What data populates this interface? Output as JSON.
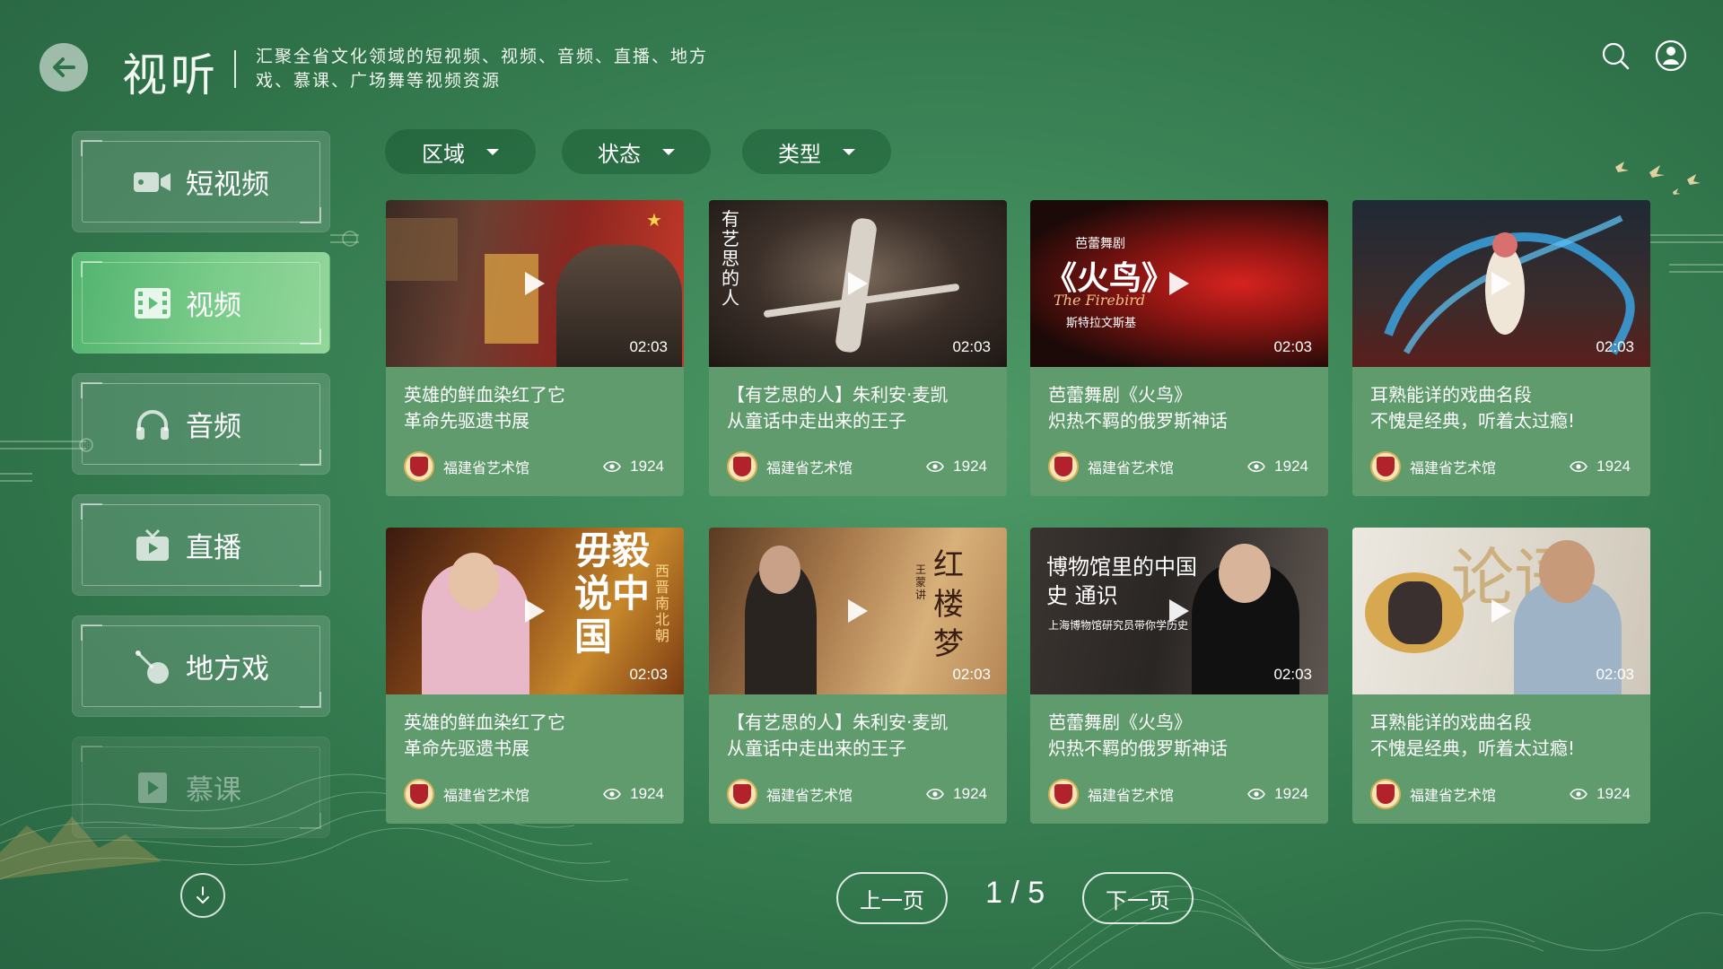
{
  "header": {
    "title": "视听",
    "description": "汇聚全省文化领域的短视频、视频、音频、直播、地方戏、慕课、广场舞等视频资源"
  },
  "sidebar": {
    "items": [
      {
        "label": "短视频",
        "icon": "video-camera-icon"
      },
      {
        "label": "视频",
        "icon": "film-icon"
      },
      {
        "label": "音频",
        "icon": "headphones-icon"
      },
      {
        "label": "直播",
        "icon": "tv-icon"
      },
      {
        "label": "地方戏",
        "icon": "opera-icon"
      },
      {
        "label": "慕课",
        "icon": "course-play-icon"
      }
    ],
    "active_index": 1
  },
  "filters": [
    {
      "label": "区域"
    },
    {
      "label": "状态"
    },
    {
      "label": "类型"
    }
  ],
  "cards": [
    {
      "line1": "英雄的鲜血染红了它",
      "line2": "革命先驱遗书展",
      "duration": "02:03",
      "org": "福建省艺术馆",
      "views": "1924"
    },
    {
      "line1": "【有艺思的人】朱利安·麦凯",
      "line2": "从童话中走出来的王子",
      "duration": "02:03",
      "org": "福建省艺术馆",
      "views": "1924",
      "overlay": "有艺思的人"
    },
    {
      "line1": "芭蕾舞剧《火鸟》",
      "line2": "炽热不羁的俄罗斯神话",
      "duration": "02:03",
      "org": "福建省艺术馆",
      "views": "1924",
      "overlay_small": "芭蕾舞剧",
      "overlay_big": "《火鸟》",
      "overlay_en": "The Firebird",
      "overlay_sub": "斯特拉文斯基"
    },
    {
      "line1": "耳熟能详的戏曲名段",
      "line2": "不愧是经典，听着太过瘾!",
      "duration": "02:03",
      "org": "福建省艺术馆",
      "views": "1924"
    },
    {
      "line1": "英雄的鲜血染红了它",
      "line2": "革命先驱遗书展",
      "duration": "02:03",
      "org": "福建省艺术馆",
      "views": "1924",
      "overlay": "毋毅说中国",
      "overlay_side": "西晋南北朝"
    },
    {
      "line1": "【有艺思的人】朱利安·麦凯",
      "line2": "从童话中走出来的王子",
      "duration": "02:03",
      "org": "福建省艺术馆",
      "views": "1924",
      "overlay": "红楼梦",
      "overlay_side": "王蒙讲"
    },
    {
      "line1": "芭蕾舞剧《火鸟》",
      "line2": "炽热不羁的俄罗斯神话",
      "duration": "02:03",
      "org": "福建省艺术馆",
      "views": "1924",
      "overlay": "博物馆里的中国史 通识",
      "overlay_sub": "上海博物馆研究员带你学历史"
    },
    {
      "line1": "耳熟能详的戏曲名段",
      "line2": "不愧是经典，听着太过瘾!",
      "duration": "02:03",
      "org": "福建省艺术馆",
      "views": "1924",
      "overlay": "论语"
    }
  ],
  "pagination": {
    "prev_label": "上一页",
    "next_label": "下一页",
    "indicator": "1 / 5",
    "current": 1,
    "total": 5
  },
  "colors": {
    "background": "#3d8658",
    "active_item": "#6cc382",
    "card": "#5f9b6c"
  }
}
